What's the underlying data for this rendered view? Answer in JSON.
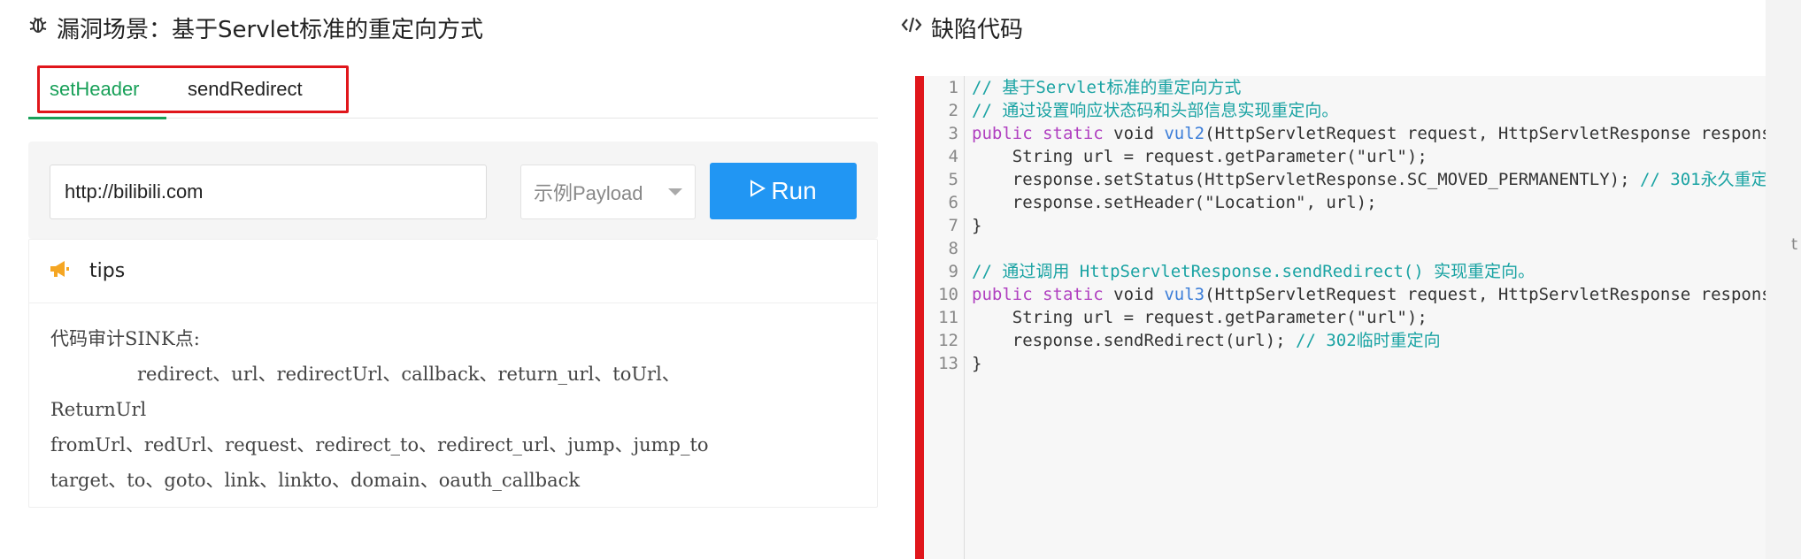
{
  "left": {
    "title_icon": "bug-icon",
    "title": "漏洞场景：基于Servlet标准的重定向方式",
    "tabs": [
      {
        "label": "setHeader",
        "active": true
      },
      {
        "label": "sendRedirect",
        "active": false
      }
    ],
    "input": {
      "value": "http://bilibili.com"
    },
    "payload_select": {
      "label": "示例Payload"
    },
    "run_button": {
      "label": "Run",
      "icon": "play-icon"
    },
    "tips": {
      "icon": "megaphone-icon",
      "label": "tips",
      "lines": [
        "代码审计SINK点:",
        "redirect、url、redirectUrl、callback、return_url、toUrl、",
        "ReturnUrl",
        "fromUrl、redUrl、request、redirect_to、redirect_url、jump、jump_to",
        "target、to、goto、link、linkto、domain、oauth_callback"
      ]
    }
  },
  "right": {
    "title_icon": "code-icon",
    "title": "缺陷代码",
    "line_numbers": [
      "1",
      "2",
      "3",
      "4",
      "5",
      "6",
      "7",
      "8",
      "9",
      "10",
      "11",
      "12",
      "13"
    ],
    "code": [
      [
        {
          "t": "// 基于Servlet标准的重定向方式",
          "c": "cm"
        }
      ],
      [
        {
          "t": "// 通过设置响应状态码和头部信息实现重定向。",
          "c": "cm"
        }
      ],
      [
        {
          "t": "public ",
          "c": "kw"
        },
        {
          "t": "static ",
          "c": "kw"
        },
        {
          "t": "void ",
          "c": ""
        },
        {
          "t": "vul2",
          "c": "fn"
        },
        {
          "t": "(HttpServletRequest request, HttpServletResponse response",
          "c": ""
        }
      ],
      [
        {
          "t": "    String url = request.getParameter(\"url\");",
          "c": ""
        }
      ],
      [
        {
          "t": "    response.setStatus(HttpServletResponse.SC_MOVED_PERMANENTLY); ",
          "c": ""
        },
        {
          "t": "// 301永久重定",
          "c": "cm"
        }
      ],
      [
        {
          "t": "    response.setHeader(\"Location\", url);",
          "c": ""
        }
      ],
      [
        {
          "t": "}",
          "c": ""
        }
      ],
      [
        {
          "t": "",
          "c": ""
        }
      ],
      [
        {
          "t": "// 通过调用 HttpServletResponse.sendRedirect() 实现重定向。",
          "c": "cm"
        }
      ],
      [
        {
          "t": "public ",
          "c": "kw"
        },
        {
          "t": "static ",
          "c": "kw"
        },
        {
          "t": "void ",
          "c": ""
        },
        {
          "t": "vul3",
          "c": "fn"
        },
        {
          "t": "(HttpServletRequest request, HttpServletResponse response",
          "c": ""
        }
      ],
      [
        {
          "t": "    String url = request.getParameter(\"url\");",
          "c": ""
        }
      ],
      [
        {
          "t": "    response.sendRedirect(url); ",
          "c": ""
        },
        {
          "t": "// 302临时重定向",
          "c": "cm"
        }
      ],
      [
        {
          "t": "}",
          "c": ""
        }
      ]
    ]
  },
  "colors": {
    "accent_green": "#18a058",
    "run_blue": "#2196f3",
    "highlight_red": "#e0161b",
    "tips_icon": "#f5a623",
    "code_keyword": "#b040c0",
    "code_function": "#3b7dd8",
    "code_comment": "#1aa3a3"
  }
}
